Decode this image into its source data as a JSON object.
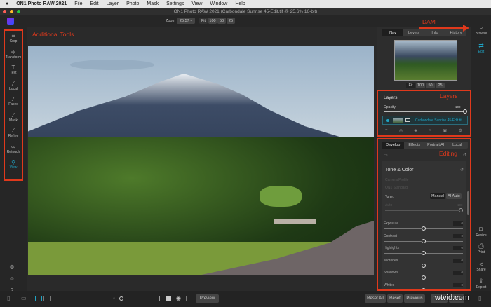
{
  "menubar": {
    "app": "ON1 Photo RAW 2021",
    "items": [
      "File",
      "Edit",
      "Layer",
      "Photo",
      "Mask",
      "Settings",
      "View",
      "Window",
      "Help"
    ]
  },
  "title": "ON1 Photo RAW 2021 (Carbondale Sunrise 45-Edit.tif @ 25.6% 16-bit)",
  "toolbar": {
    "zoom_label": "Zoom",
    "zoom_value": "25.57",
    "zoom_buttons": [
      "Fit",
      "100",
      "50",
      "25"
    ]
  },
  "tools": [
    {
      "label": "Crop",
      "icon": "crop-icon",
      "g": "⌗"
    },
    {
      "label": "Transform",
      "icon": "transform-icon",
      "g": "✛"
    },
    {
      "label": "Text",
      "icon": "text-icon",
      "g": "T"
    },
    {
      "label": "Local",
      "icon": "local-brush-icon",
      "g": "⁄"
    },
    {
      "label": "Faces",
      "icon": "faces-icon",
      "g": "⁄"
    },
    {
      "label": "Mask",
      "icon": "mask-icon",
      "g": "⁄"
    },
    {
      "label": "Refine",
      "icon": "refine-icon",
      "g": "⁄"
    },
    {
      "label": "Retouch",
      "icon": "retouch-icon",
      "g": "∞"
    },
    {
      "label": "View",
      "icon": "view-zoom-icon",
      "g": "⚲"
    }
  ],
  "annotations": {
    "tools": "Additional Tools",
    "dam": "DAM",
    "layers": "Layers",
    "editing": "Editing"
  },
  "nav": {
    "tabs": [
      "Nav",
      "Levels",
      "Info",
      "History"
    ],
    "zoom_buttons": [
      "Fit",
      "100",
      "50",
      "25"
    ]
  },
  "layers": {
    "title": "Layers",
    "opacity_label": "Opacity",
    "opacity_value": "100",
    "layer_name": "Carbondale Sunrise 45-Edit.tif"
  },
  "develop": {
    "tabs": [
      "Develop",
      "Effects",
      "Portrait AI",
      "Local"
    ],
    "section": "Tone & Color",
    "camera_profile_label": "Camera Profile",
    "camera_profile_value": "ON1 Standard",
    "tone_label": "Tone:",
    "tone_modes": [
      "Manual",
      "AI Auto"
    ],
    "auto_label": "Auto",
    "auto_value": "100",
    "sliders": [
      {
        "label": "Exposure",
        "value": "0"
      },
      {
        "label": "Contrast",
        "value": "0"
      },
      {
        "label": "Highlights",
        "value": "0"
      },
      {
        "label": "Midtones",
        "value": "0"
      },
      {
        "label": "Shadows",
        "value": "0"
      },
      {
        "label": "Whites",
        "value": "0"
      }
    ]
  },
  "right_icons": [
    {
      "label": "Browse",
      "icon": "browse-icon"
    },
    {
      "label": "Edit",
      "icon": "edit-icon"
    },
    {
      "label": "Resize",
      "icon": "resize-icon"
    },
    {
      "label": "Print",
      "icon": "print-icon"
    },
    {
      "label": "Share",
      "icon": "share-icon"
    },
    {
      "label": "Export",
      "icon": "export-icon"
    }
  ],
  "bottom": {
    "preview": "Preview",
    "reset_all": "Reset All",
    "reset": "Reset",
    "previous": "Previous",
    "cancel": "Cancel",
    "done": "Done"
  },
  "watermark": "wtvid.com",
  "colors": {
    "accent": "#1fa3c4",
    "annotation": "#e0391c"
  }
}
